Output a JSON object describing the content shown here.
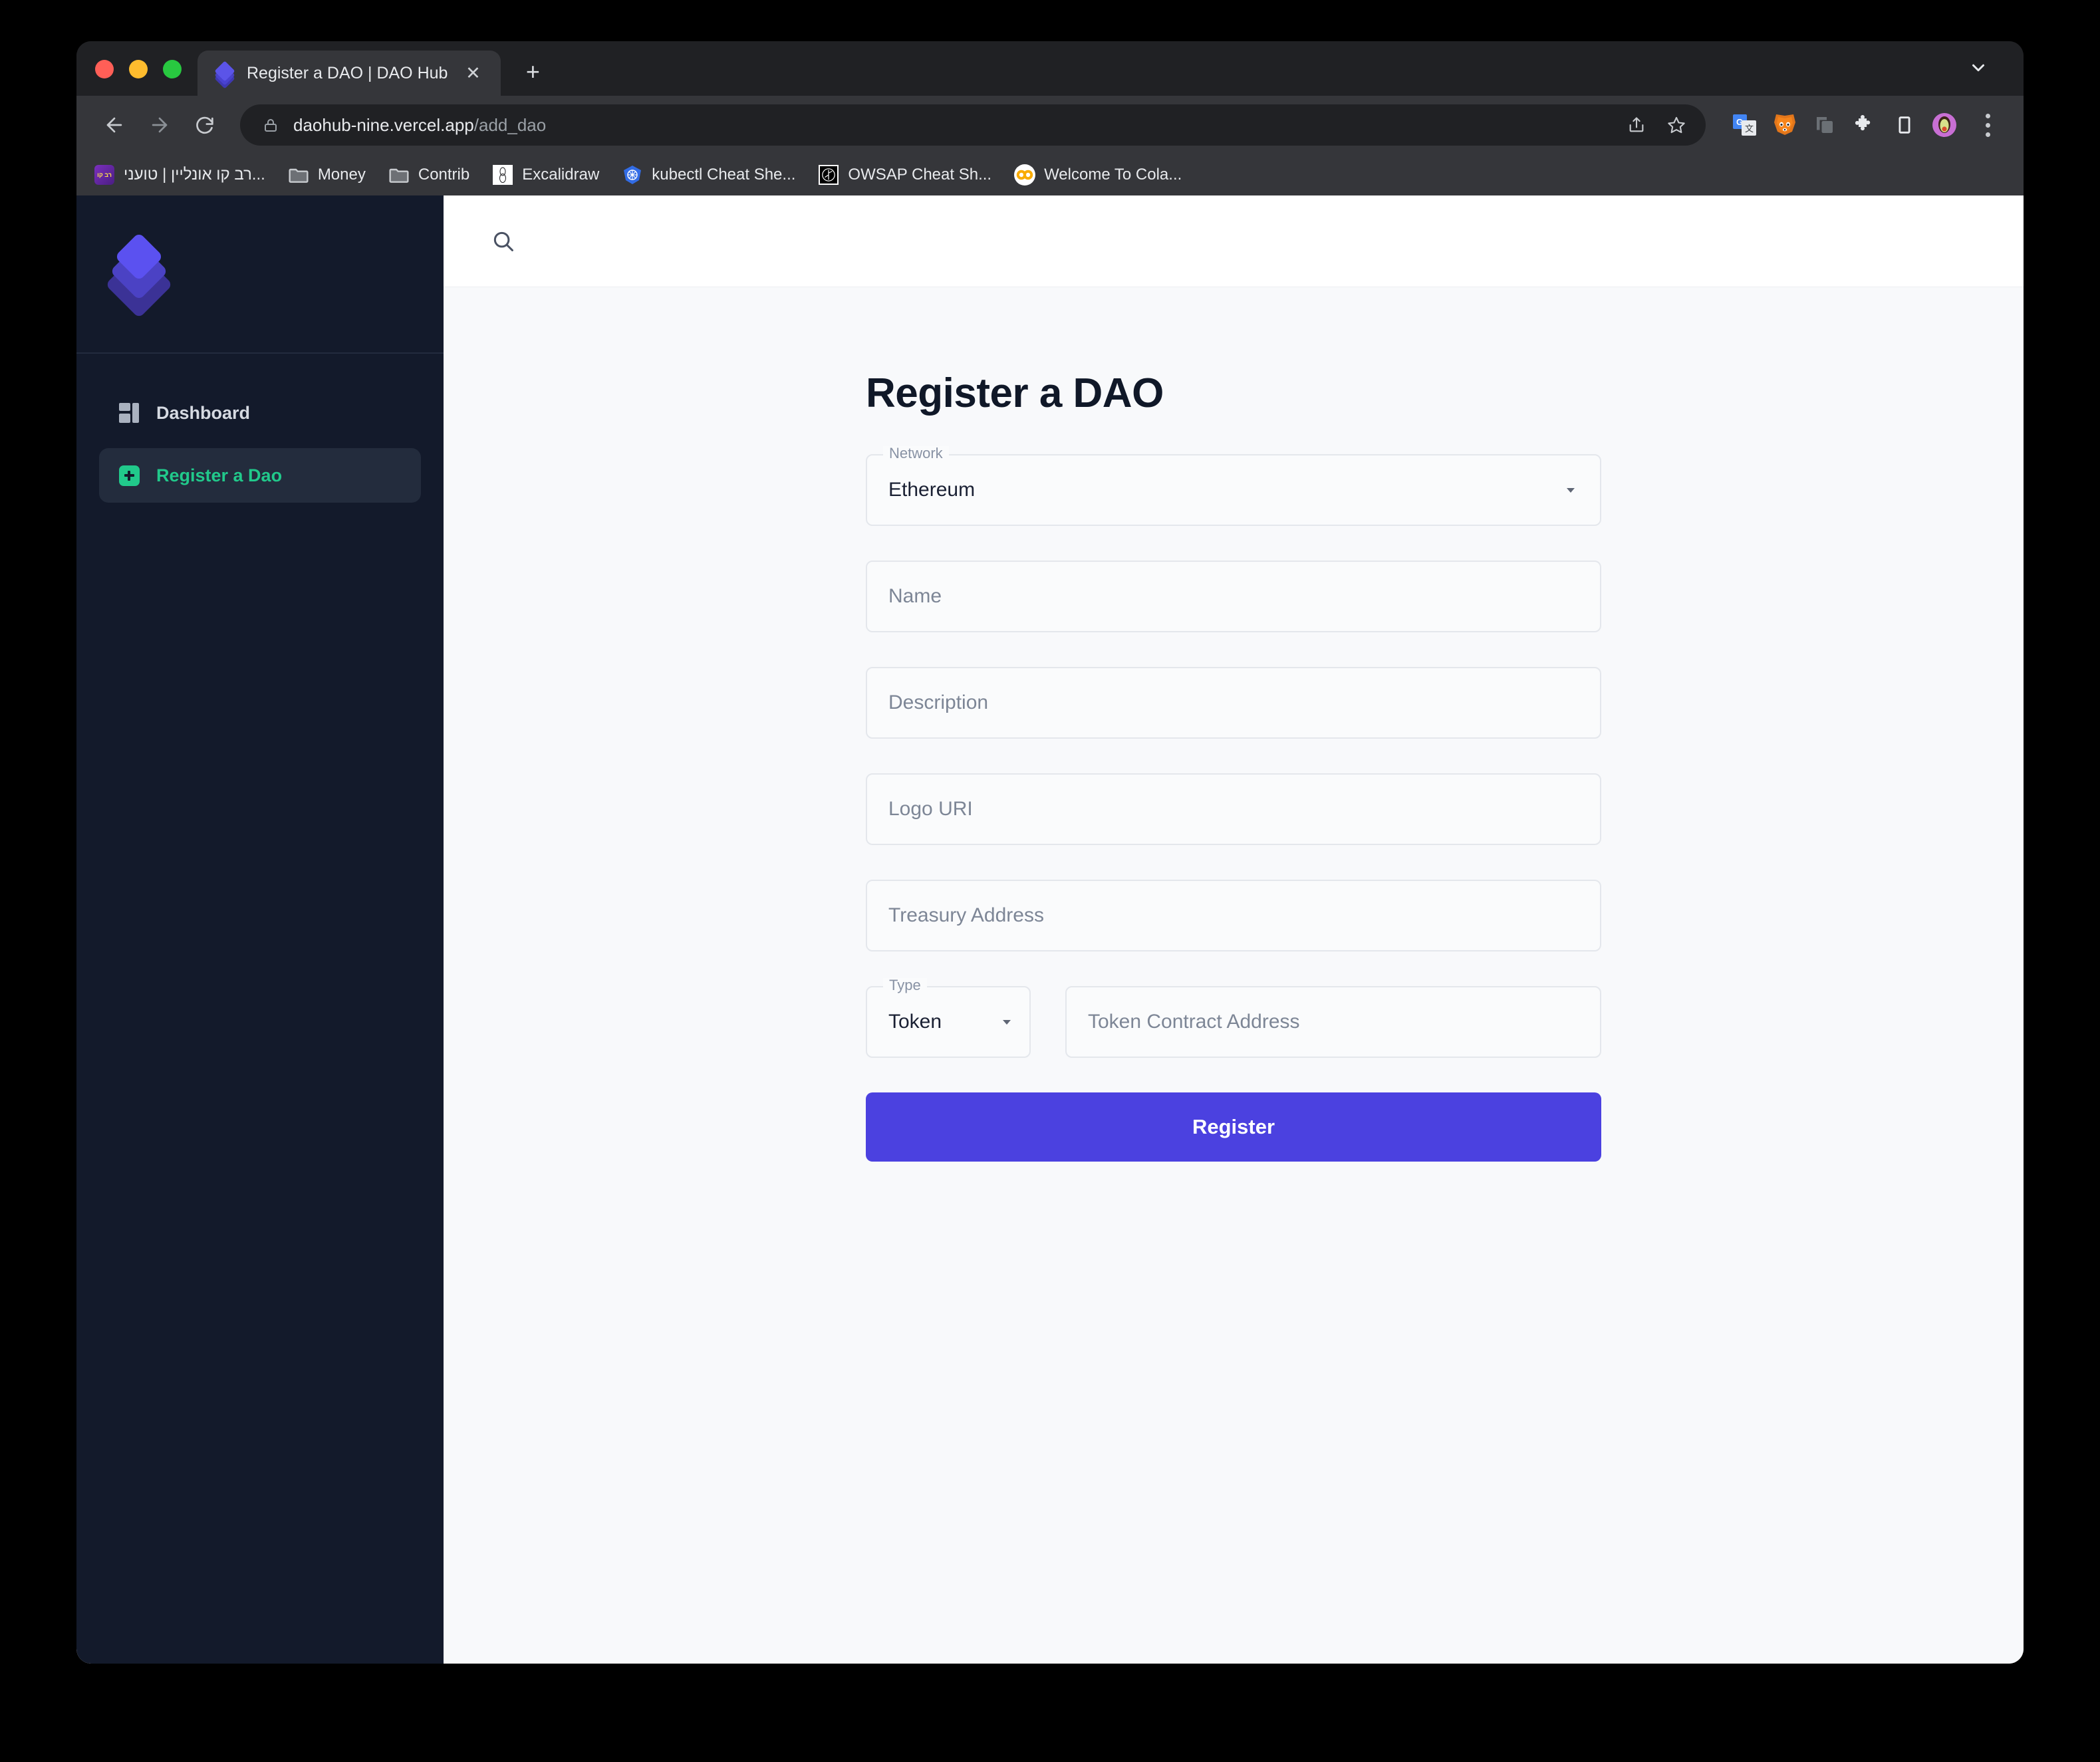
{
  "browser": {
    "window_controls": [
      "close",
      "minimize",
      "maximize"
    ],
    "tab": {
      "title": "Register a DAO | DAO Hub",
      "close_label": "✕",
      "favicon": "dao-hub-layers-icon"
    },
    "new_tab_label": "+",
    "tab_list_icon": "chevron-down-icon",
    "nav": {
      "back_icon": "arrow-left-icon",
      "forward_icon": "arrow-right-icon",
      "reload_icon": "reload-icon"
    },
    "omnibox": {
      "lock_icon": "lock-icon",
      "domain": "daohub-nine.vercel.app",
      "path": "/add_dao",
      "share_icon": "share-icon",
      "bookmark_icon": "star-icon"
    },
    "extensions": [
      {
        "name": "google-translate-icon",
        "label": "Google Translate"
      },
      {
        "name": "metamask-icon",
        "label": "MetaMask"
      },
      {
        "name": "window-capture-icon",
        "label": "Screen Capture"
      },
      {
        "name": "puzzle-icon",
        "label": "Extensions"
      },
      {
        "name": "side-panel-icon",
        "label": "Side panel"
      },
      {
        "name": "profile-avatar",
        "label": "Profile"
      }
    ],
    "menu_icon": "three-dot-menu-icon",
    "bookmarks": [
      {
        "label": "רב קו אונליין | טועני...",
        "icon": "rav-kav-favicon"
      },
      {
        "label": "Money",
        "icon": "folder-icon"
      },
      {
        "label": "Contrib",
        "icon": "folder-icon"
      },
      {
        "label": "Excalidraw",
        "icon": "excalidraw-favicon"
      },
      {
        "label": "kubectl Cheat She...",
        "icon": "kubernetes-favicon"
      },
      {
        "label": "OWSAP Cheat Sh...",
        "icon": "owasp-favicon"
      },
      {
        "label": "Welcome To Cola...",
        "icon": "colab-favicon"
      }
    ]
  },
  "app": {
    "sidebar": {
      "logo_icon": "stacked-layers-logo",
      "items": [
        {
          "label": "Dashboard",
          "icon": "dashboard-grid-icon",
          "active": false
        },
        {
          "label": "Register a Dao",
          "icon": "plus-square-icon",
          "active": true
        }
      ]
    },
    "header": {
      "search_icon": "search-icon"
    },
    "main": {
      "title": "Register a DAO",
      "fields": {
        "network": {
          "legend": "Network",
          "value": "Ethereum",
          "caret_icon": "chevron-down-icon"
        },
        "name": {
          "placeholder": "Name",
          "value": ""
        },
        "description": {
          "placeholder": "Description",
          "value": ""
        },
        "logo_uri": {
          "placeholder": "Logo URI",
          "value": ""
        },
        "treasury_address": {
          "placeholder": "Treasury Address",
          "value": ""
        },
        "type": {
          "legend": "Type",
          "value": "Token",
          "caret_icon": "chevron-down-icon"
        },
        "token_contract_address": {
          "placeholder": "Token Contract Address",
          "value": ""
        }
      },
      "submit_label": "Register"
    }
  },
  "colors": {
    "sidebar_bg": "#131a2b",
    "sidebar_active_bg": "#232c3d",
    "accent_green": "#21c98b",
    "accent_indigo": "#4b41e0",
    "page_bg": "#f8f9fb",
    "header_bg": "#ffffff"
  }
}
